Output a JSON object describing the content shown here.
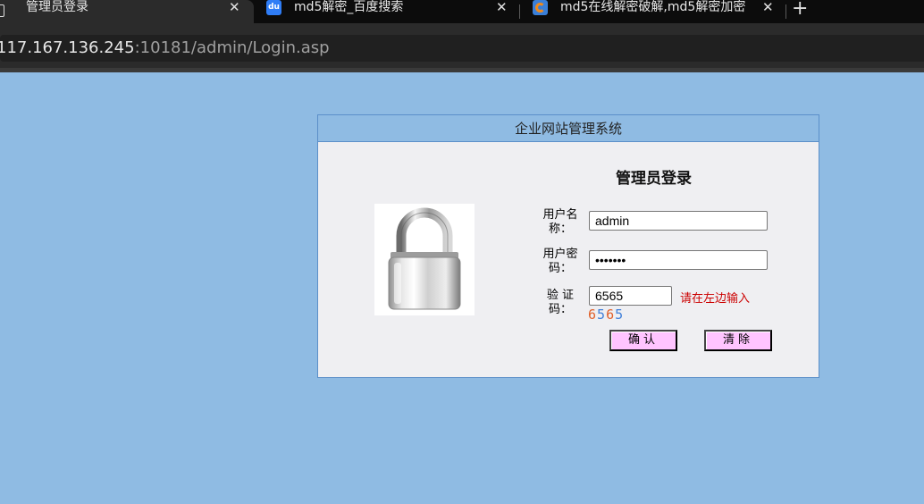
{
  "browser": {
    "tabs": [
      {
        "title": "管理员登录",
        "icon": "page-icon",
        "active": true
      },
      {
        "title": "md5解密_百度搜索",
        "icon": "baidu-icon",
        "active": false
      },
      {
        "title": "md5在线解密破解,md5解密加密",
        "icon": "md5-site-icon",
        "active": false
      }
    ],
    "close_glyph": "✕",
    "new_tab_glyph": "+",
    "url_host": "117.167.136.245",
    "url_rest": ":10181/admin/Login.asp"
  },
  "page": {
    "header": "企业网站管理系统",
    "title": "管理员登录",
    "username_label": "用户名称：",
    "username_value": "admin",
    "password_label": "用户密码：",
    "password_value": "•••••••",
    "captcha_label": "验 证 码：",
    "captcha_value": "6565",
    "captcha_hint": "请在左边输入",
    "captcha_image_chars": [
      "6",
      "5",
      "6",
      "5"
    ],
    "captcha_colors": [
      "#e0602a",
      "#3f7fd9",
      "#e0602a",
      "#3f7fd9"
    ],
    "confirm_label": "确认",
    "clear_label": "清除",
    "lock_image": "padlock-icon"
  },
  "colors": {
    "page_background": "#8fbbe3",
    "button_background": "#ffc4ff",
    "hint_text": "#cc0000"
  }
}
